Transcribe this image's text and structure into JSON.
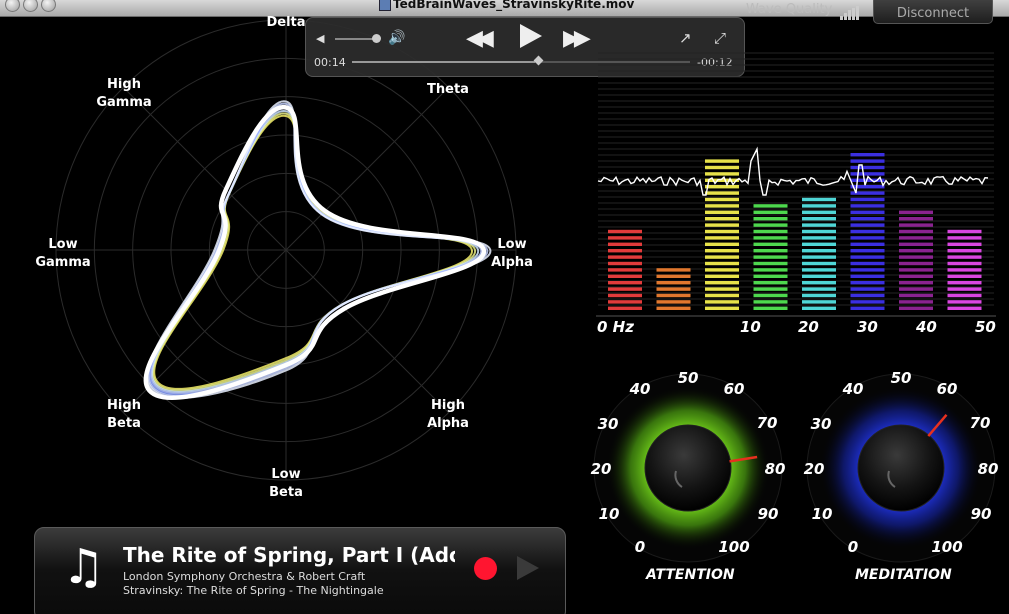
{
  "window": {
    "title": "TedBrainWaves_StravinskyRite.mov",
    "wave_quality_label": "Wave Quality",
    "disconnect_label": "Disconnect"
  },
  "player": {
    "elapsed": "00:14",
    "remaining": "-00:12",
    "progress": 0.54,
    "volume": 0.85
  },
  "radar": {
    "labels": [
      {
        "id": "delta",
        "text": "Delta"
      },
      {
        "id": "theta",
        "text": "Theta"
      },
      {
        "id": "low-alpha",
        "text": "Low\nAlpha"
      },
      {
        "id": "high-alpha",
        "text": "High\nAlpha"
      },
      {
        "id": "low-beta",
        "text": "Low\nBeta"
      },
      {
        "id": "high-beta",
        "text": "High\nBeta"
      },
      {
        "id": "low-gamma",
        "text": "Low\nGamma"
      },
      {
        "id": "high-gamma",
        "text": "High\nGamma"
      }
    ],
    "current_levels": [
      0.62,
      0.24,
      0.86,
      0.36,
      0.5,
      0.85,
      0.29,
      0.37
    ]
  },
  "spectrum": {
    "axis_labels": [
      "0 Hz",
      "10",
      "20",
      "30",
      "40",
      "50"
    ],
    "bars": [
      {
        "color": "#e23b3b",
        "level": 0.52
      },
      {
        "color": "#e0772e",
        "level": 0.28
      },
      {
        "color": "#e7e24a",
        "level": 0.96
      },
      {
        "color": "#4ed84e",
        "level": 0.67
      },
      {
        "color": "#4fd6d6",
        "level": 0.72
      },
      {
        "color": "#3b2fe0",
        "level": 1.0
      },
      {
        "color": "#8a2390",
        "level": 0.62
      },
      {
        "color": "#d946e0",
        "level": 0.52
      }
    ]
  },
  "dials": {
    "scale": [
      "0",
      "10",
      "20",
      "30",
      "40",
      "50",
      "60",
      "70",
      "80",
      "90",
      "100"
    ],
    "attention": {
      "label": "ATTENTION",
      "value": 80,
      "glow": "#7bdc1d"
    },
    "meditation": {
      "label": "MEDITATION",
      "value": 65,
      "glow": "#1c2fd8"
    }
  },
  "now_playing": {
    "title": "The Rite of Spring, Part I (Adoration of the Earth)",
    "artist": "London Symphony Orchestra & Robert Craft",
    "album": "Stravinsky: The Rite of Spring - The Nightingale"
  }
}
